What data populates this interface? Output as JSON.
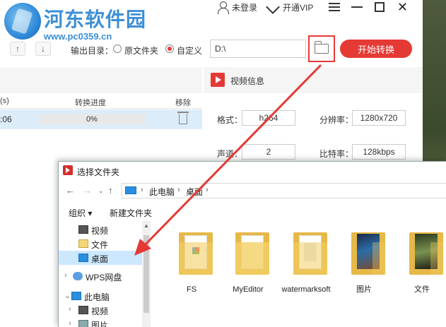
{
  "watermark": {
    "title": "河东软件园",
    "url": "www.pc0359.cn"
  },
  "titlebar": {
    "login": "未登录",
    "vip": "开通VIP"
  },
  "toolbar": {
    "output_label": "输出目录：",
    "option_source": "原文件夹",
    "option_custom": "自定义",
    "selected_option": "custom",
    "path_value": "D:\\",
    "start_label": "开始转换"
  },
  "list": {
    "columns": [
      "(s)",
      "转换进度",
      "移除"
    ],
    "rows": [
      {
        "time": ":06",
        "progress_text": "0%",
        "progress": 0
      }
    ]
  },
  "info": {
    "title": "视频信息",
    "format_label": "格式：",
    "format_value": "h264",
    "resolution_label": "分辨率：",
    "resolution_value": "1280x720",
    "channel_label": "声道：",
    "channel_value": "2",
    "bitrate_label": "比特率：",
    "bitrate_value": "128kbps"
  },
  "dialog": {
    "title": "选择文件夹",
    "breadcrumb": [
      "此电脑",
      "桌面"
    ],
    "commands": {
      "organize": "组织 ▾",
      "new_folder": "新建文件夹"
    },
    "nav": {
      "video": "视频",
      "docs": "文件",
      "desktop": "桌面",
      "wps": "WPS网盘",
      "pc": "此电脑",
      "pc_video": "视频",
      "pc_pictures": "图片"
    },
    "files": [
      "FS",
      "MyEditor",
      "watermarksoft",
      "图片",
      "文件"
    ]
  },
  "colors": {
    "accent": "#e53935",
    "selection": "#cce8ff",
    "folder": "#f3cf66"
  }
}
